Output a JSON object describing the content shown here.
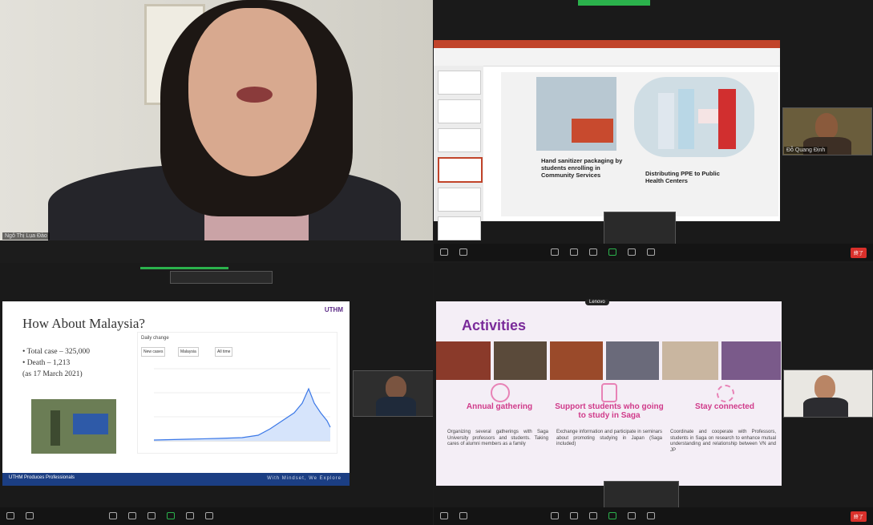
{
  "q1": {
    "name_tag": "Ngô Thị Lụa Đào"
  },
  "q2": {
    "caption1": "Hand sanitizer packaging by students enrolling in Community Services",
    "caption2": "Distributing PPE to Public Health Centers",
    "thumb_name": "Đỗ Quang Định"
  },
  "q3": {
    "title": "How About Malaysia?",
    "bullet1": "• Total case – 325,000",
    "bullet2": "• Death – 1,213",
    "bullet3": "(as 17 March 2021)",
    "logo": "UTHM",
    "chart_label": "Daily change",
    "filter1": "New cases",
    "filter2": "Malaysia",
    "filter3": "All time",
    "footer_right": "With Mindset, We Explore",
    "footer_left": "UTHM Produces Professionals"
  },
  "q4": {
    "title": "Activities",
    "col1_title": "Annual gathering",
    "col2_title": "Support students who going to study in Saga",
    "col3_title": "Stay connected",
    "col1_body": "Organizing several gatherings with Saga University professors and students. Taking cares of alumni members as a family",
    "col2_body": "Exchange information and participate in seminars about promoting studying in Japan (Saga included)",
    "col3_body": "Coordinate and cooperate with Professors, students in Saga on research to enhance mutual understanding and relationship between VN and JP",
    "lenovo": "Lenovo"
  },
  "toolbar": {
    "end_label": "終了"
  }
}
